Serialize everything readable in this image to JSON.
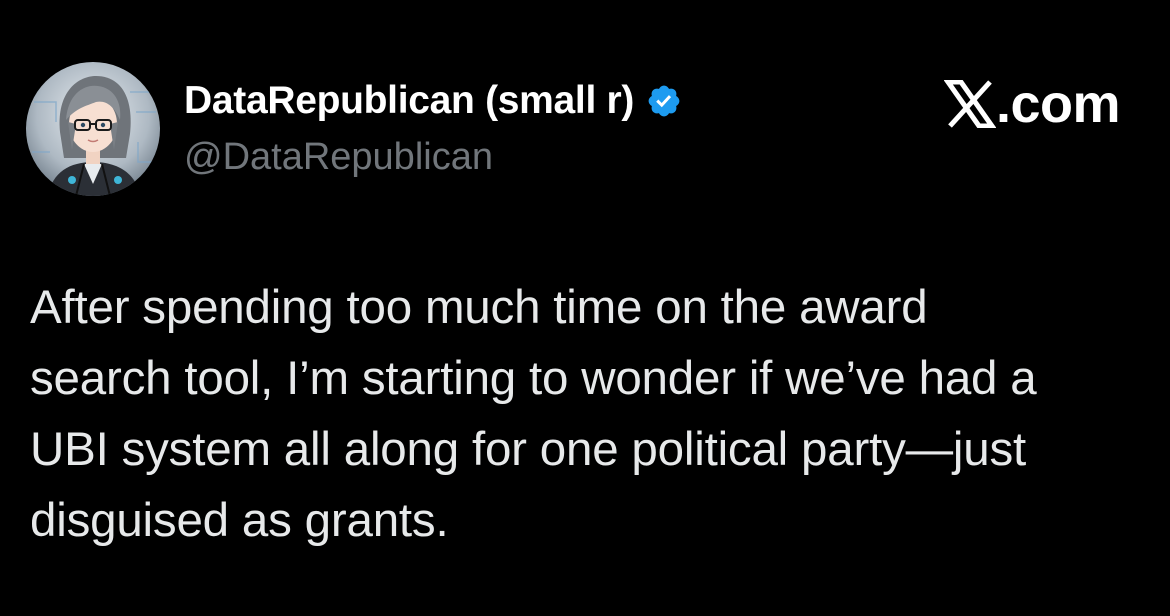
{
  "author": {
    "display_name": "DataRepublican (small r)",
    "handle": "@DataRepublican",
    "verified": true,
    "avatar_icon": "anime-avatar-with-glasses"
  },
  "brand": {
    "icon": "x-logo-icon",
    "domain": ".com"
  },
  "tweet": {
    "lines": [
      "After spending too much time on the award",
      "search tool, I’m starting to wonder if we’ve had a",
      "UBI system all along for one political party—just",
      "disguised as grants."
    ]
  },
  "colors": {
    "background": "#000000",
    "primary_text": "#e7e9ea",
    "secondary_text": "#71767b",
    "verified_blue": "#1d9bf0"
  }
}
